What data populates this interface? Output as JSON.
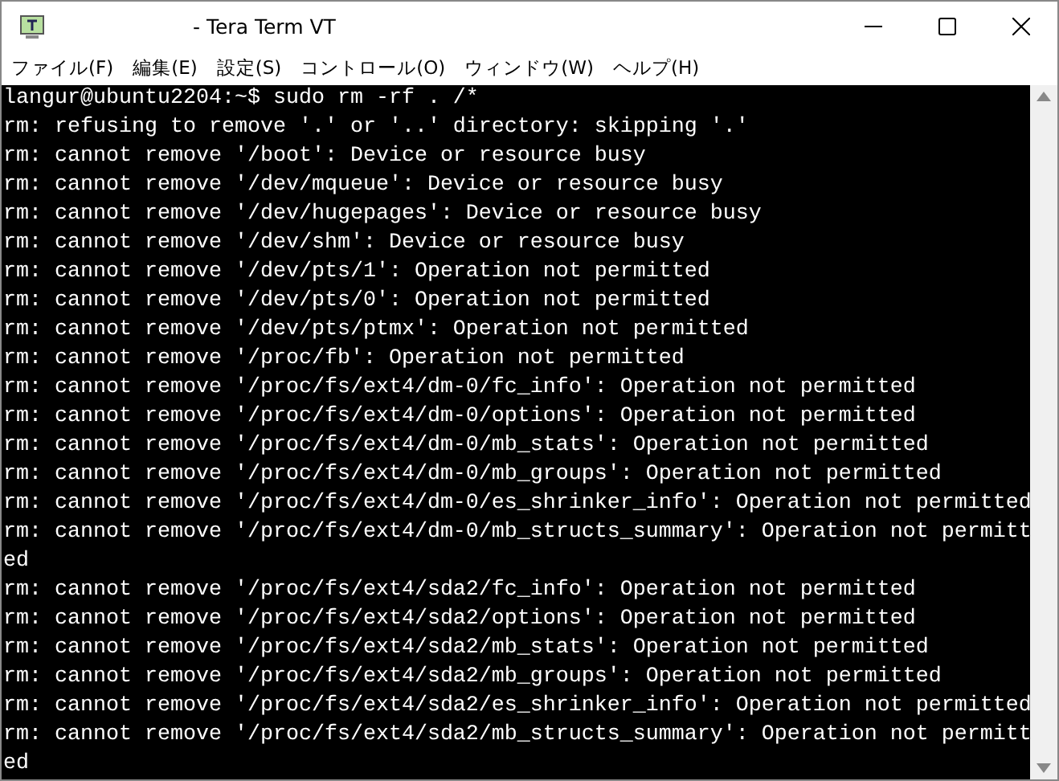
{
  "window": {
    "title": "- Tera Term VT"
  },
  "menu": [
    "ファイル(F)",
    "編集(E)",
    "設定(S)",
    "コントロール(O)",
    "ウィンドウ(W)",
    "ヘルプ(H)"
  ],
  "terminal": {
    "lines": [
      "langur@ubuntu2204:~$ sudo rm -rf . /*",
      "rm: refusing to remove '.' or '..' directory: skipping '.'",
      "rm: cannot remove '/boot': Device or resource busy",
      "rm: cannot remove '/dev/mqueue': Device or resource busy",
      "rm: cannot remove '/dev/hugepages': Device or resource busy",
      "rm: cannot remove '/dev/shm': Device or resource busy",
      "rm: cannot remove '/dev/pts/1': Operation not permitted",
      "rm: cannot remove '/dev/pts/0': Operation not permitted",
      "rm: cannot remove '/dev/pts/ptmx': Operation not permitted",
      "rm: cannot remove '/proc/fb': Operation not permitted",
      "rm: cannot remove '/proc/fs/ext4/dm-0/fc_info': Operation not permitted",
      "rm: cannot remove '/proc/fs/ext4/dm-0/options': Operation not permitted",
      "rm: cannot remove '/proc/fs/ext4/dm-0/mb_stats': Operation not permitted",
      "rm: cannot remove '/proc/fs/ext4/dm-0/mb_groups': Operation not permitted",
      "rm: cannot remove '/proc/fs/ext4/dm-0/es_shrinker_info': Operation not permitted",
      "rm: cannot remove '/proc/fs/ext4/dm-0/mb_structs_summary': Operation not permitt",
      "ed",
      "rm: cannot remove '/proc/fs/ext4/sda2/fc_info': Operation not permitted",
      "rm: cannot remove '/proc/fs/ext4/sda2/options': Operation not permitted",
      "rm: cannot remove '/proc/fs/ext4/sda2/mb_stats': Operation not permitted",
      "rm: cannot remove '/proc/fs/ext4/sda2/mb_groups': Operation not permitted",
      "rm: cannot remove '/proc/fs/ext4/sda2/es_shrinker_info': Operation not permitted",
      "rm: cannot remove '/proc/fs/ext4/sda2/mb_structs_summary': Operation not permitt",
      "ed"
    ]
  }
}
